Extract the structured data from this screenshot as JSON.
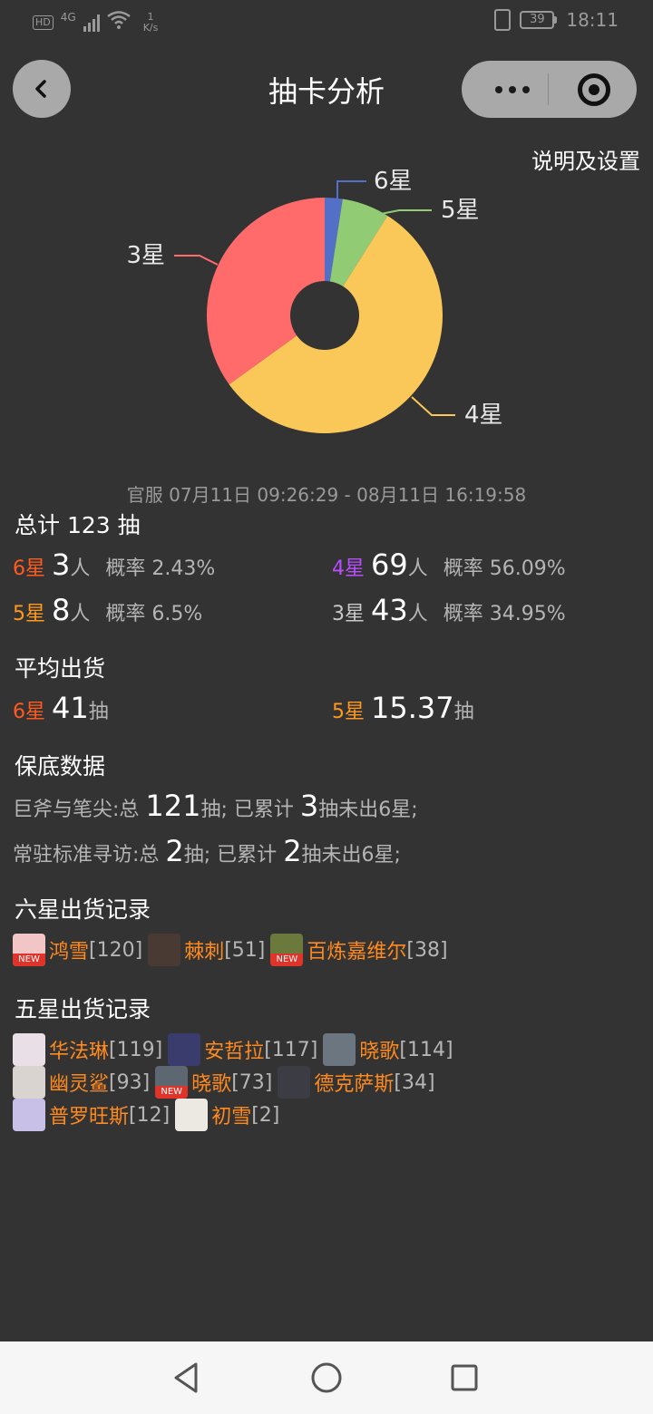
{
  "status_bar": {
    "hd": "HD",
    "network": "4G",
    "speed_value": "1",
    "speed_unit": "K/s",
    "battery": "39",
    "time": "18:11"
  },
  "header": {
    "title": "抽卡分析",
    "settings_link": "说明及设置"
  },
  "chart_data": {
    "type": "pie",
    "labels": [
      "6星",
      "5星",
      "4星",
      "3星"
    ],
    "values": [
      3,
      8,
      69,
      43
    ],
    "colors": [
      "#5470c6",
      "#91cc75",
      "#fac858",
      "#ff6b6b"
    ]
  },
  "time_range": "官服 07月11日 09:26:29 - 08月11日 16:19:58",
  "summary": {
    "title": "总计 123 抽",
    "rows": [
      {
        "star": "6星",
        "count": "3",
        "unit": "人",
        "rate_label": "概率",
        "rate": "2.43%"
      },
      {
        "star": "4星",
        "count": "69",
        "unit": "人",
        "rate_label": "概率",
        "rate": "56.09%"
      },
      {
        "star": "5星",
        "count": "8",
        "unit": "人",
        "rate_label": "概率",
        "rate": "6.5%"
      },
      {
        "star": "3星",
        "count": "43",
        "unit": "人",
        "rate_label": "概率",
        "rate": "34.95%"
      }
    ]
  },
  "average": {
    "title": "平均出货",
    "six": {
      "star": "6星",
      "value": "41",
      "unit": "抽"
    },
    "five": {
      "star": "5星",
      "value": "15.37",
      "unit": "抽"
    }
  },
  "pity": {
    "title": "保底数据",
    "rows": [
      {
        "pool": "巨斧与笔尖:总",
        "total": "121",
        "mid": "抽; 已累计",
        "acc": "3",
        "tail": "抽未出6星;"
      },
      {
        "pool": "常驻标准寻访:总",
        "total": "2",
        "mid": "抽; 已累计",
        "acc": "2",
        "tail": "抽未出6星;"
      }
    ]
  },
  "six_star_records": {
    "title": "六星出货记录",
    "items": [
      {
        "name": "鸿雪",
        "count": "[120]",
        "new": "NEW",
        "avatar_color": "#f2c6c6"
      },
      {
        "name": "棘刺",
        "count": "[51]",
        "new": "",
        "avatar_color": "#4a3a34"
      },
      {
        "name": "百炼嘉维尔",
        "count": "[38]",
        "new": "NEW",
        "avatar_color": "#6b7a3c"
      }
    ]
  },
  "five_star_records": {
    "title": "五星出货记录",
    "items": [
      {
        "name": "华法琳",
        "count": "[119]",
        "new": "",
        "avatar_color": "#e8e0e6"
      },
      {
        "name": "安哲拉",
        "count": "[117]",
        "new": "",
        "avatar_color": "#3a3c6e"
      },
      {
        "name": "晓歌",
        "count": "[114]",
        "new": "",
        "avatar_color": "#6c7680"
      },
      {
        "name": "幽灵鲨",
        "count": "[93]",
        "new": "",
        "avatar_color": "#d9d4d0"
      },
      {
        "name": "晓歌",
        "count": "[73]",
        "new": "NEW",
        "avatar_color": "#5d6772"
      },
      {
        "name": "德克萨斯",
        "count": "[34]",
        "new": "",
        "avatar_color": "#3c3c44"
      },
      {
        "name": "普罗旺斯",
        "count": "[12]",
        "new": "",
        "avatar_color": "#c8c0e6"
      },
      {
        "name": "初雪",
        "count": "[2]",
        "new": "",
        "avatar_color": "#ece8e2"
      }
    ]
  }
}
